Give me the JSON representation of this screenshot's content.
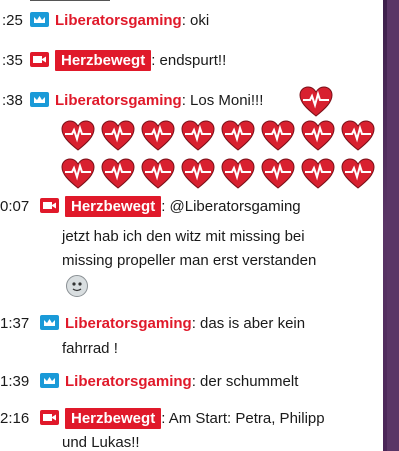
{
  "messages": [
    {
      "time": "",
      "user": "",
      "text": ""
    },
    {
      "time": ":25",
      "user": "Liberatorsgaming",
      "text": ": oki"
    },
    {
      "time": ":35",
      "user": "Herzbewegt",
      "text": ": endspurt!!"
    },
    {
      "time": ":38",
      "user": "Liberatorsgaming",
      "text": ": Los Moni!!!"
    },
    {
      "time": "0:07",
      "user": "Herzbewegt",
      "text": ": @Liberatorsgaming",
      "line2": "jetzt hab ich den witz mit missing bei",
      "line3": "missing propeller man erst verstanden"
    },
    {
      "time": "1:37",
      "user": "Liberatorsgaming",
      "text": ": das is aber kein",
      "line2": "fahrrad !"
    },
    {
      "time": "1:39",
      "user": "Liberatorsgaming",
      "text": ": der schummelt"
    },
    {
      "time": "2:16",
      "user": "Herzbewegt",
      "text": ": Am Start: Petra, Philipp",
      "line2": "und Lukas!!"
    }
  ],
  "icons": {
    "moderator": "crown-icon",
    "broadcaster": "camera-icon",
    "heart": "heart-ecg-icon",
    "emote": "face-emote-icon"
  },
  "colors": {
    "user_red": "#e0192a",
    "mod_blue": "#1a9ad8",
    "frame_purple": "#5a3566"
  }
}
